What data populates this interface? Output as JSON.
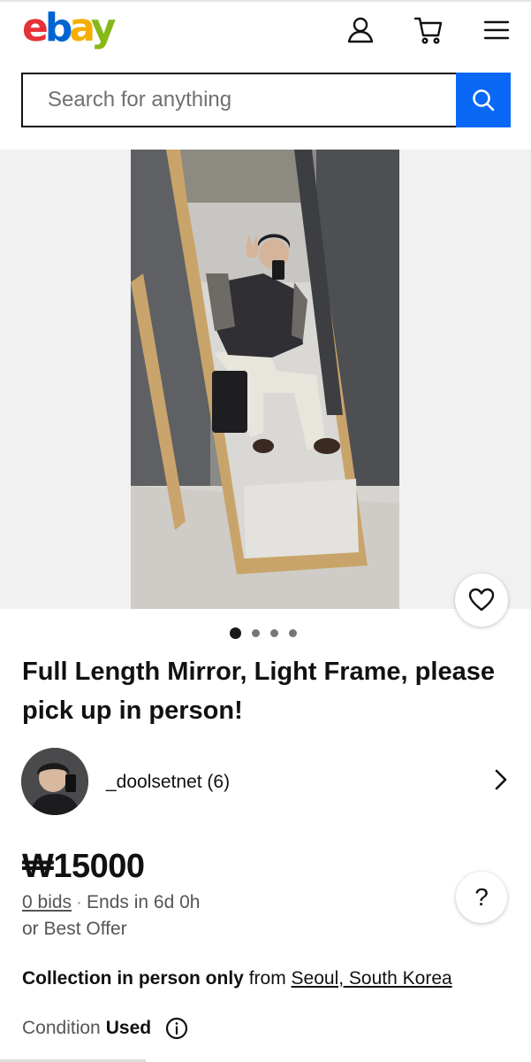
{
  "header": {
    "logo": {
      "e": "e",
      "b": "b",
      "a": "a",
      "y": "y"
    },
    "account_icon": "user-icon",
    "cart_icon": "cart-icon",
    "menu_icon": "hamburger-menu-icon"
  },
  "search": {
    "placeholder": "Search for anything",
    "button_icon": "search-icon",
    "button_color": "#0968f6"
  },
  "gallery": {
    "image_count": 4,
    "active_index": 1,
    "watch_icon": "heart-icon"
  },
  "listing": {
    "title": "Full Length Mirror, Light Frame, please pick up in person!",
    "seller": {
      "name": "_doolsetnet (6)"
    },
    "price": "₩15000",
    "bids": "0 bids",
    "ends": "Ends in 6d 0h",
    "best_offer": "or Best Offer",
    "help_label": "?",
    "collection": {
      "label": "Collection in person only",
      "from": "from",
      "location": "Seoul, South Korea"
    },
    "condition": {
      "label": "Condition",
      "value": "Used"
    }
  },
  "colors": {
    "ebay_red": "#e53238",
    "ebay_blue": "#0064d2",
    "ebay_yellow": "#f5af02",
    "ebay_green": "#86b817"
  }
}
